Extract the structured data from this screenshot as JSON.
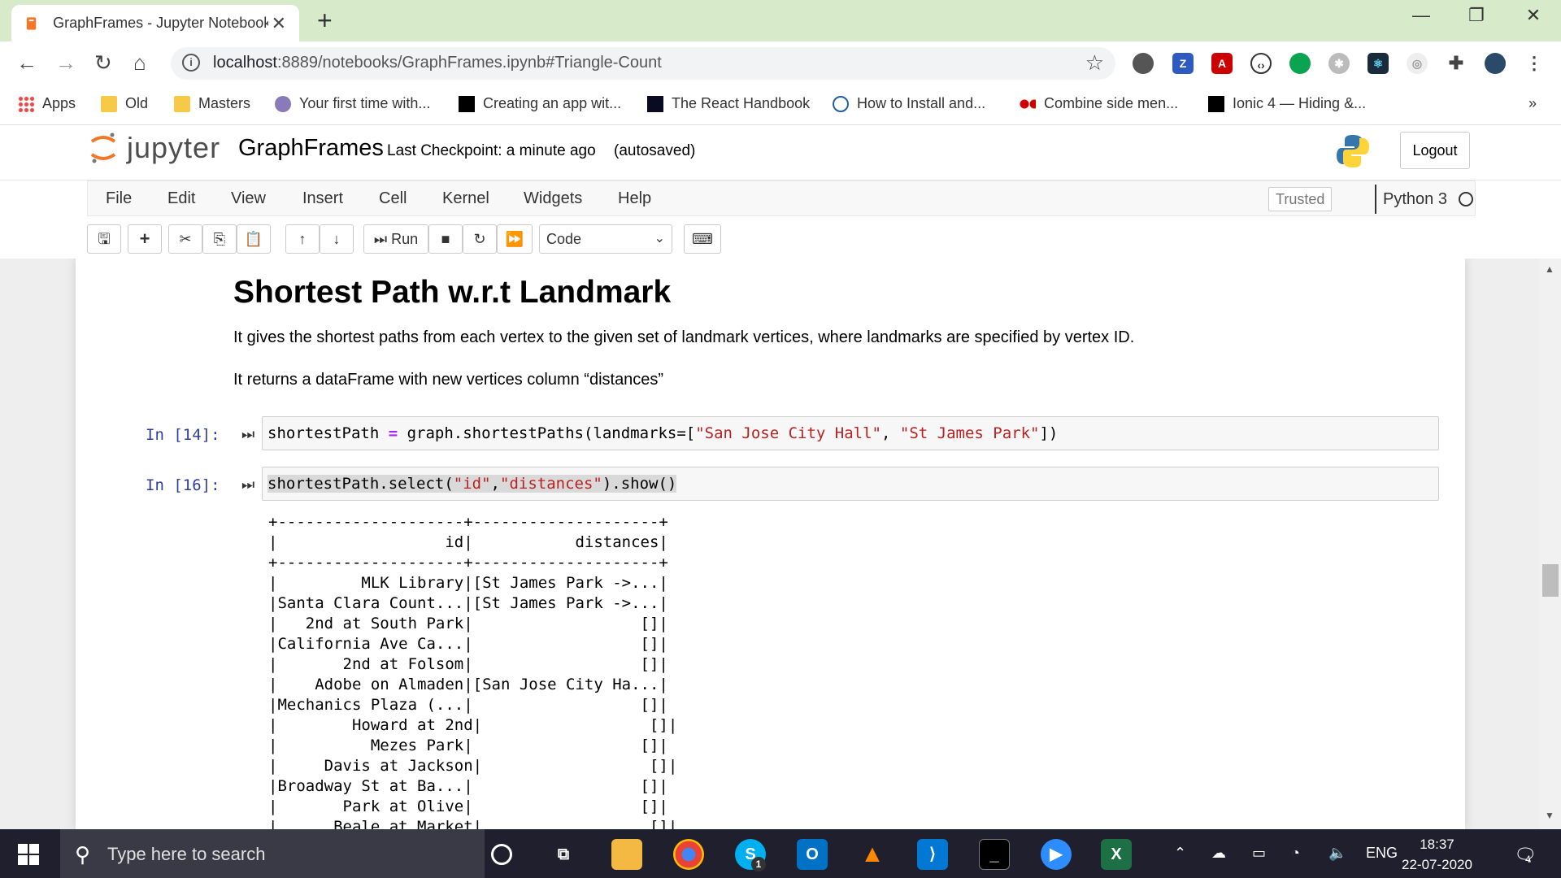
{
  "browser": {
    "tab_title": "GraphFrames - Jupyter Notebook",
    "new_tab": "+",
    "url_host": "localhost",
    "url_rest": ":8889/notebooks/GraphFrames.ipynb#Triangle-Count",
    "bookmarks": [
      {
        "label": "Apps"
      },
      {
        "label": "Old"
      },
      {
        "label": "Masters"
      },
      {
        "label": "Your first time with..."
      },
      {
        "label": "Creating an app wit..."
      },
      {
        "label": "The React Handbook"
      },
      {
        "label": "How to Install and..."
      },
      {
        "label": "Combine side men..."
      },
      {
        "label": "Ionic 4 — Hiding &..."
      }
    ],
    "more_bookmarks": "»"
  },
  "jupyter": {
    "logo_text": "jupyter",
    "notebook_name": "GraphFrames",
    "checkpoint": "Last Checkpoint: a minute ago",
    "autosaved": "(autosaved)",
    "logout": "Logout",
    "menus": [
      "File",
      "Edit",
      "View",
      "Insert",
      "Cell",
      "Kernel",
      "Widgets",
      "Help"
    ],
    "trusted": "Trusted",
    "kernel_name": "Python 3",
    "run_label": "Run",
    "cell_type": "Code"
  },
  "notebook": {
    "heading": "Shortest Path w.r.t Landmark",
    "para1": "It gives the shortest paths from each vertex to the given set of landmark vertices, where landmarks are specified by vertex ID.",
    "para2": "It returns a dataFrame with new vertices column “distances”",
    "cells": [
      {
        "prompt": "In [14]:",
        "code_a": "shortestPath ",
        "code_op": "=",
        "code_b": " graph.shortestPaths(landmarks=[",
        "str1": "\"San Jose City Hall\"",
        "code_c": ", ",
        "str2": "\"St James Park\"",
        "code_d": "])"
      },
      {
        "prompt": "In [16]:",
        "code_a": "shortestPath.select(",
        "str1": "\"id\"",
        "code_b": ",",
        "str2": "\"distances\"",
        "code_c": ").show()"
      }
    ],
    "output": "+--------------------+--------------------+\n|                  id|           distances|\n+--------------------+--------------------+\n|         MLK Library|[St James Park ->...|\n|Santa Clara Count...|[St James Park ->...|\n|   2nd at South Park|                  []|\n|California Ave Ca...|                  []|\n|       2nd at Folsom|                  []|\n|    Adobe on Almaden|[San Jose City Ha...|\n|Mechanics Plaza (...|                  []|\n|        Howard at 2nd|                  []|\n|          Mezes Park|                  []|\n|     Davis at Jackson|                  []|\n|Broadway St at Ba...|                  []|\n|       Park at Olive|                  []|\n|      Beale at Market|                  []|"
  },
  "taskbar": {
    "search_placeholder": "Type here to search",
    "language": "ENG",
    "time": "18:37",
    "date": "22-07-2020",
    "notification_count": "4",
    "skype_badge": "1"
  }
}
